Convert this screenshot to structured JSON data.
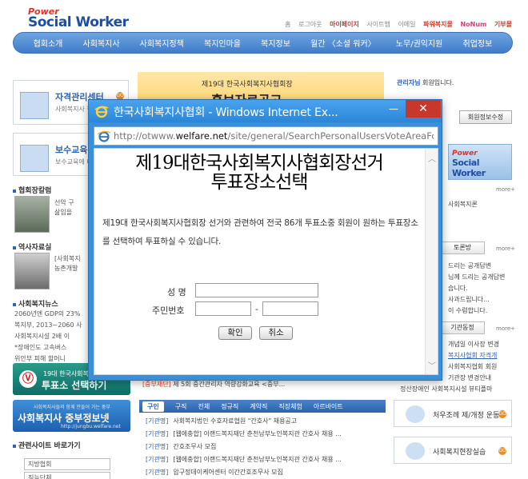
{
  "site": {
    "logo_small": "Power",
    "logo_big": "Social Worker",
    "util_links": [
      "홈",
      "로그아웃",
      "마이페이지",
      "사이트맵",
      "이메일"
    ],
    "util_brand": "파워복지몰",
    "util_brand2": "NoNum",
    "util_brand3": "기부몰",
    "nav": [
      "협회소개",
      "사회복지사",
      "사회복지정책",
      "복지인마을",
      "복지정보",
      "월간 〈소셜 워커〉",
      "노무/권익지원",
      "취업정보"
    ],
    "left": {
      "box1_title": "자격관리센터",
      "box1_desc": "사회복지사 정보를 확인",
      "box2_title": "보수교육",
      "box2_desc": "보수교육에 내역을 확인",
      "sec_president": "협회장칼럼",
      "president_text": [
        "선악 구",
        "삶입을"
      ],
      "sec_history": "역사자료실",
      "history_text": [
        "[사회복지",
        "농촌개발"
      ],
      "sec_news": "사회복지뉴스",
      "news": [
        "2060년엔 GDP의 23%",
        "복지부, 2013~2060 사",
        "사회복지시설 2배 이",
        "*장애인도 고속버스",
        "위안부 피해 할머니"
      ],
      "vote_small": "19대 한국사회복지",
      "vote_big": "투표소 선택하기",
      "vote_mark": "Ⓥ",
      "jb_small": "사회복지사들의 함께 만들어 가는 중부",
      "jb_big": "사회복지사 중부정보넷",
      "jb_url": "http://jungbu.welfare.net",
      "sec_related": "관련사이트 바로가기",
      "select1": "지방협회",
      "select2": "직능단체"
    },
    "center": {
      "banner_small": "제19대 한국사회복지사협회장",
      "banner_big": "홍보자료공고",
      "news_tag": "[중부재단]",
      "news_text": "제 5회 중간관리자 역량강화교육 <중부...",
      "jobs_tabs": [
        "구인",
        "구직",
        "전체",
        "정규직",
        "계약직",
        "직장체험",
        "아르바이트"
      ],
      "jobs": [
        {
          "tag": "[기관명]",
          "text": "사회복지법인 수호자료협원 \"간호사\" 채용공고"
        },
        {
          "tag": "[기관명]",
          "text": "[웹에충합] 이랜드복지재단 춘천남부노인복지관 간호사 채용 ..."
        },
        {
          "tag": "[기관명]",
          "text": "간호조무사 모집"
        },
        {
          "tag": "[기관명]",
          "text": "[웹에충합] 이랜드복지재단 춘천남부노인복지관 간호사 채용 ..."
        },
        {
          "tag": "[기관명]",
          "text": "압구정데이케어센터 이간간호조무사 모집"
        }
      ]
    },
    "right": {
      "login_name": "관리자님",
      "login_suffix": "회원입니다.",
      "btn_edit": "회원정보수정",
      "more": "more+",
      "text1": "사회복지론",
      "tab_debate": "토론방",
      "debate": [
        "드리는 공개답변",
        "님께 드리는 공개답변",
        "습니다.",
        "사과드립니다...",
        "이 수렴합니다."
      ],
      "tab_org": "기관동정",
      "org": [
        "개념일 이사장 변경",
        "복지사협회 자격개",
        "사회복지협회 회원",
        "기관장 변경안내",
        "정산장애인 사회복지시설 뷰티플마"
      ],
      "banner1": "처우조례 제/개정 운동",
      "banner2": "사회복지현장실습"
    }
  },
  "popup": {
    "window_title": "한국사회복지사협회 - Windows Internet Ex...",
    "min_glyph": "—",
    "close_glyph": "✕",
    "url_prefix": "http://otwww.",
    "url_domain": "welfare.net",
    "url_suffix": "/site/general/SearchPersonalUsersVoteAreaForm.a",
    "title_line1": "제19대한국사회복지사협회장선거",
    "title_line2": "투표장소선택",
    "desc": "제19대 한국사회복지사협회장 선거와 관련하여 전국 86개 투표소중 회원이 원하는 투표장소를 선택하여 투표하실 수 있습니다.",
    "label_name": "성 명",
    "label_id": "주민번호",
    "name_value": "",
    "id_front_value": "",
    "id_back_value": "",
    "dash": "-",
    "confirm": "확인",
    "cancel": "취소",
    "scroll_up": "︿",
    "scroll_down": "﹀"
  },
  "colors": {
    "titlebar": "#3a8fd8",
    "close_button": "#c7372a",
    "site_blue": "#2e63b0"
  }
}
